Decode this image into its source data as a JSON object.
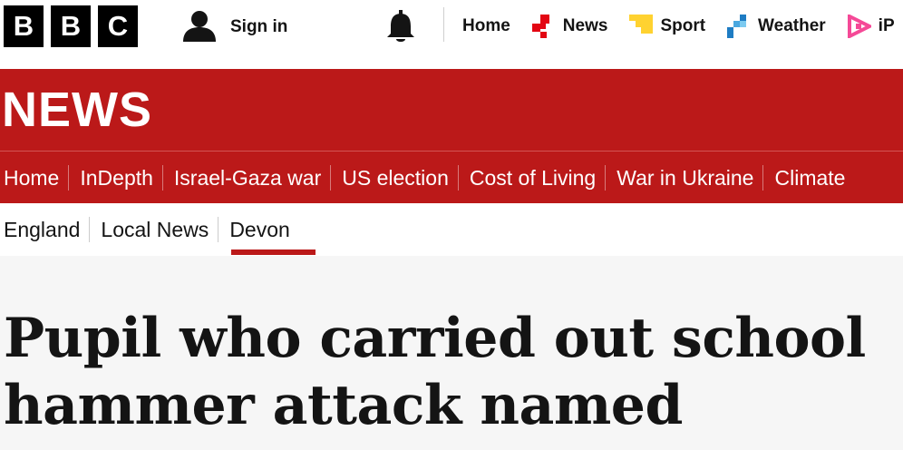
{
  "brand": {
    "letters": [
      "B",
      "B",
      "C"
    ]
  },
  "account": {
    "signin_label": "Sign in"
  },
  "topnav": [
    {
      "label": "Home",
      "icon": "none"
    },
    {
      "label": "News",
      "icon": "news-icon",
      "color": "#e30613"
    },
    {
      "label": "Sport",
      "icon": "sport-icon",
      "color": "#ffd230"
    },
    {
      "label": "Weather",
      "icon": "weather-icon",
      "color": "#1e7cc3"
    },
    {
      "label": "iP",
      "icon": "iplayer-icon",
      "color": "#f54997"
    }
  ],
  "section": {
    "title": "NEWS",
    "color": "#bb1919"
  },
  "news_nav": [
    "Home",
    "InDepth",
    "Israel-Gaza war",
    "US election",
    "Cost of Living",
    "War in Ukraine",
    "Climate"
  ],
  "sub_nav": {
    "items": [
      "England",
      "Local News",
      "Devon"
    ],
    "active": "Devon"
  },
  "article": {
    "headline": "Pupil who carried out school hammer attack named"
  }
}
